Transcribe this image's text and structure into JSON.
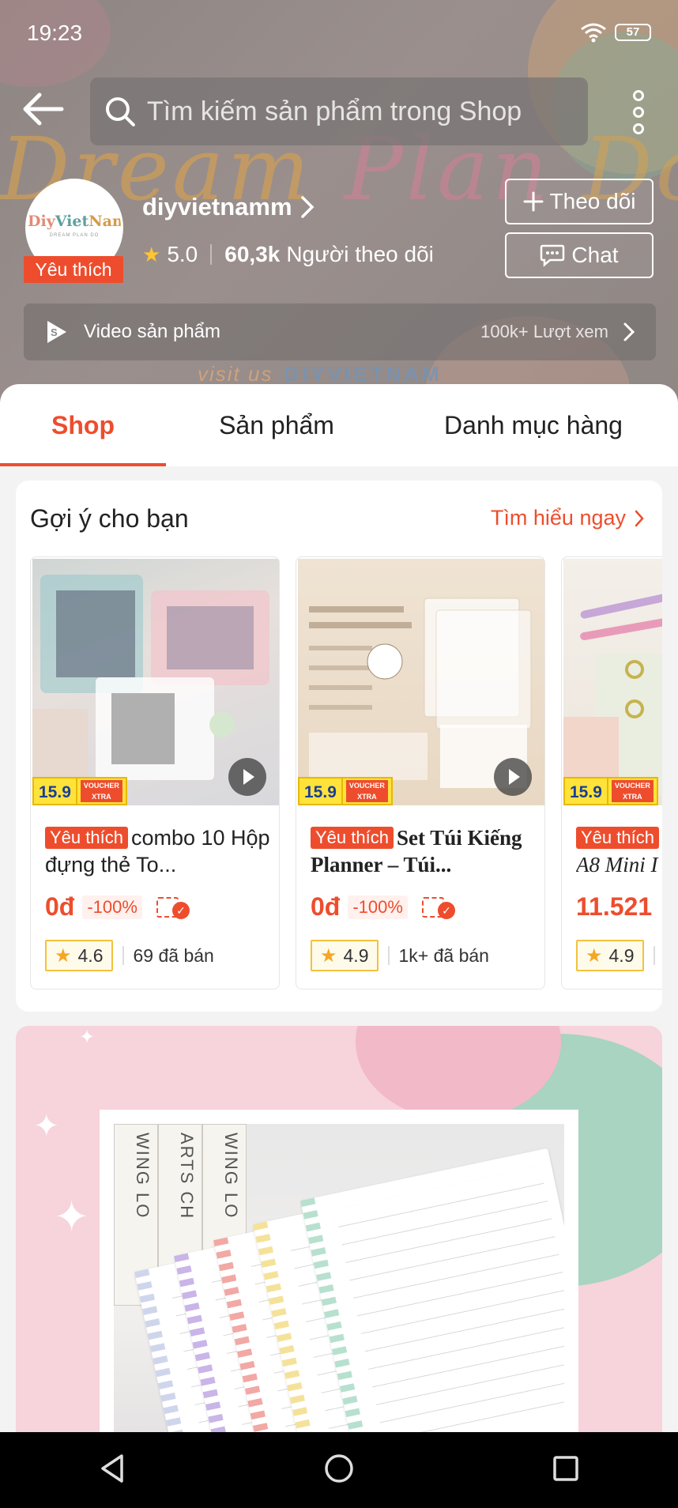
{
  "status_bar": {
    "time": "19:23",
    "battery": "57"
  },
  "search": {
    "placeholder": "Tìm kiếm sản phẩm trong Shop"
  },
  "banner": {
    "script_words": [
      "Dream",
      "Plan",
      "Do"
    ],
    "visit_text": "visit us",
    "visit_brand": "DIYVIETNAM"
  },
  "shop": {
    "name": "diyvietnamm",
    "avatar_logo": [
      "Diy",
      "Viet",
      "Nam"
    ],
    "avatar_tagline": "DREAM PLAN DO",
    "badge": "Yêu thích",
    "rating": "5.0",
    "followers_count": "60,3k",
    "followers_label": "Người theo dõi",
    "follow_label": "Theo dõi",
    "chat_label": "Chat"
  },
  "video_bar": {
    "label": "Video sản phẩm",
    "views": "100k+ Lượt xem"
  },
  "tabs": [
    {
      "label": "Shop"
    },
    {
      "label": "Sản phẩm"
    },
    {
      "label": "Danh mục hàng"
    }
  ],
  "recommend": {
    "title": "Gợi ý cho bạn",
    "more_label": "Tìm hiểu ngay",
    "promo_price": "15.9",
    "promo_voucher": [
      "VOUCHER",
      "XTRA"
    ],
    "products": [
      {
        "badge": "Yêu thích",
        "title": "combo 10 Hộp đựng thẻ To...",
        "price": "0đ",
        "discount": "-100%",
        "rating": "4.6",
        "sold": "69 đã bán"
      },
      {
        "badge": "Yêu thích",
        "title": "Set Túi Kiếng Planner – Túi...",
        "price": "0đ",
        "discount": "-100%",
        "rating": "4.9",
        "sold": "1k+ đã bán"
      },
      {
        "badge": "Yêu thích",
        "title": "A8 Mini I",
        "price": "11.521",
        "rating": "4.9"
      }
    ]
  },
  "banner2": {
    "book_spines": [
      "WING LO",
      "ARTS CH",
      "WING LO"
    ]
  },
  "colors": {
    "accent": "#ee4d2d",
    "star": "#ffc531",
    "promo_yellow": "#ffe33b"
  }
}
